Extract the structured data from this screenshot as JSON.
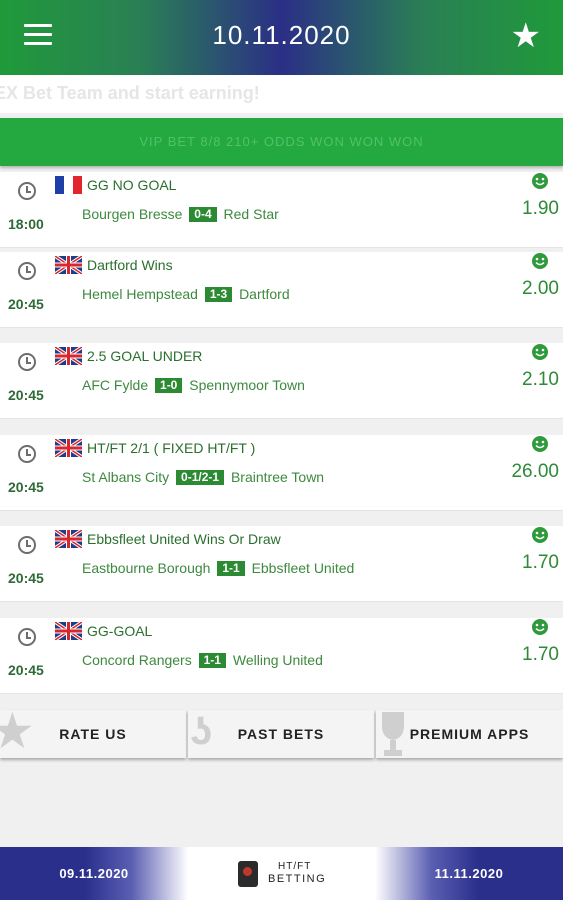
{
  "header": {
    "date": "10.11.2020",
    "menu_icon": "hamburger-menu-icon",
    "favorite_icon": "star-icon"
  },
  "marquee": {
    "text": "EX Bet Team and start earning!"
  },
  "vip_banner": {
    "text": "VIP BET 8/8 210+ ODDS WON WON WON"
  },
  "bets": [
    {
      "time": "18:00",
      "tip": "GG NO GOAL",
      "home": "Bourgen Bresse",
      "score": "0-4",
      "away": "Red Star",
      "odds": "1.90",
      "flag": "france"
    },
    {
      "time": "20:45",
      "tip": "Dartford Wins",
      "home": "Hemel Hempstead",
      "score": "1-3",
      "away": "Dartford",
      "odds": "2.00",
      "flag": "uk"
    },
    {
      "time": "20:45",
      "tip": "2.5 GOAL UNDER",
      "home": "AFC Fylde",
      "score": "1-0",
      "away": "Spennymoor Town",
      "odds": "2.10",
      "flag": "uk"
    },
    {
      "time": "20:45",
      "tip": "HT/FT 2/1 ( FIXED HT/FT )",
      "home": "St Albans City",
      "score": "0-1/2-1",
      "away": "Braintree Town",
      "odds": "26.00",
      "flag": "uk"
    },
    {
      "time": "20:45",
      "tip": "Ebbsfleet United Wins Or Draw",
      "home": "Eastbourne Borough",
      "score": "1-1",
      "away": "Ebbsfleet United",
      "odds": "1.70",
      "flag": "uk"
    },
    {
      "time": "20:45",
      "tip": "GG-GOAL",
      "home": "Concord Rangers",
      "score": "1-1",
      "away": "Welling United",
      "odds": "1.70",
      "flag": "uk"
    }
  ],
  "actions": {
    "rate": "RATE US",
    "past": "PAST BETS",
    "premium": "PREMIUM APPS"
  },
  "bottom_nav": {
    "prev_date": "09.11.2020",
    "next_date": "11.11.2020",
    "logo_line1": "HT/FT",
    "logo_line2": "BETTING"
  },
  "colors": {
    "green": "#23a93f",
    "navy": "#2a2f8c",
    "text_green": "#2f8a38"
  }
}
